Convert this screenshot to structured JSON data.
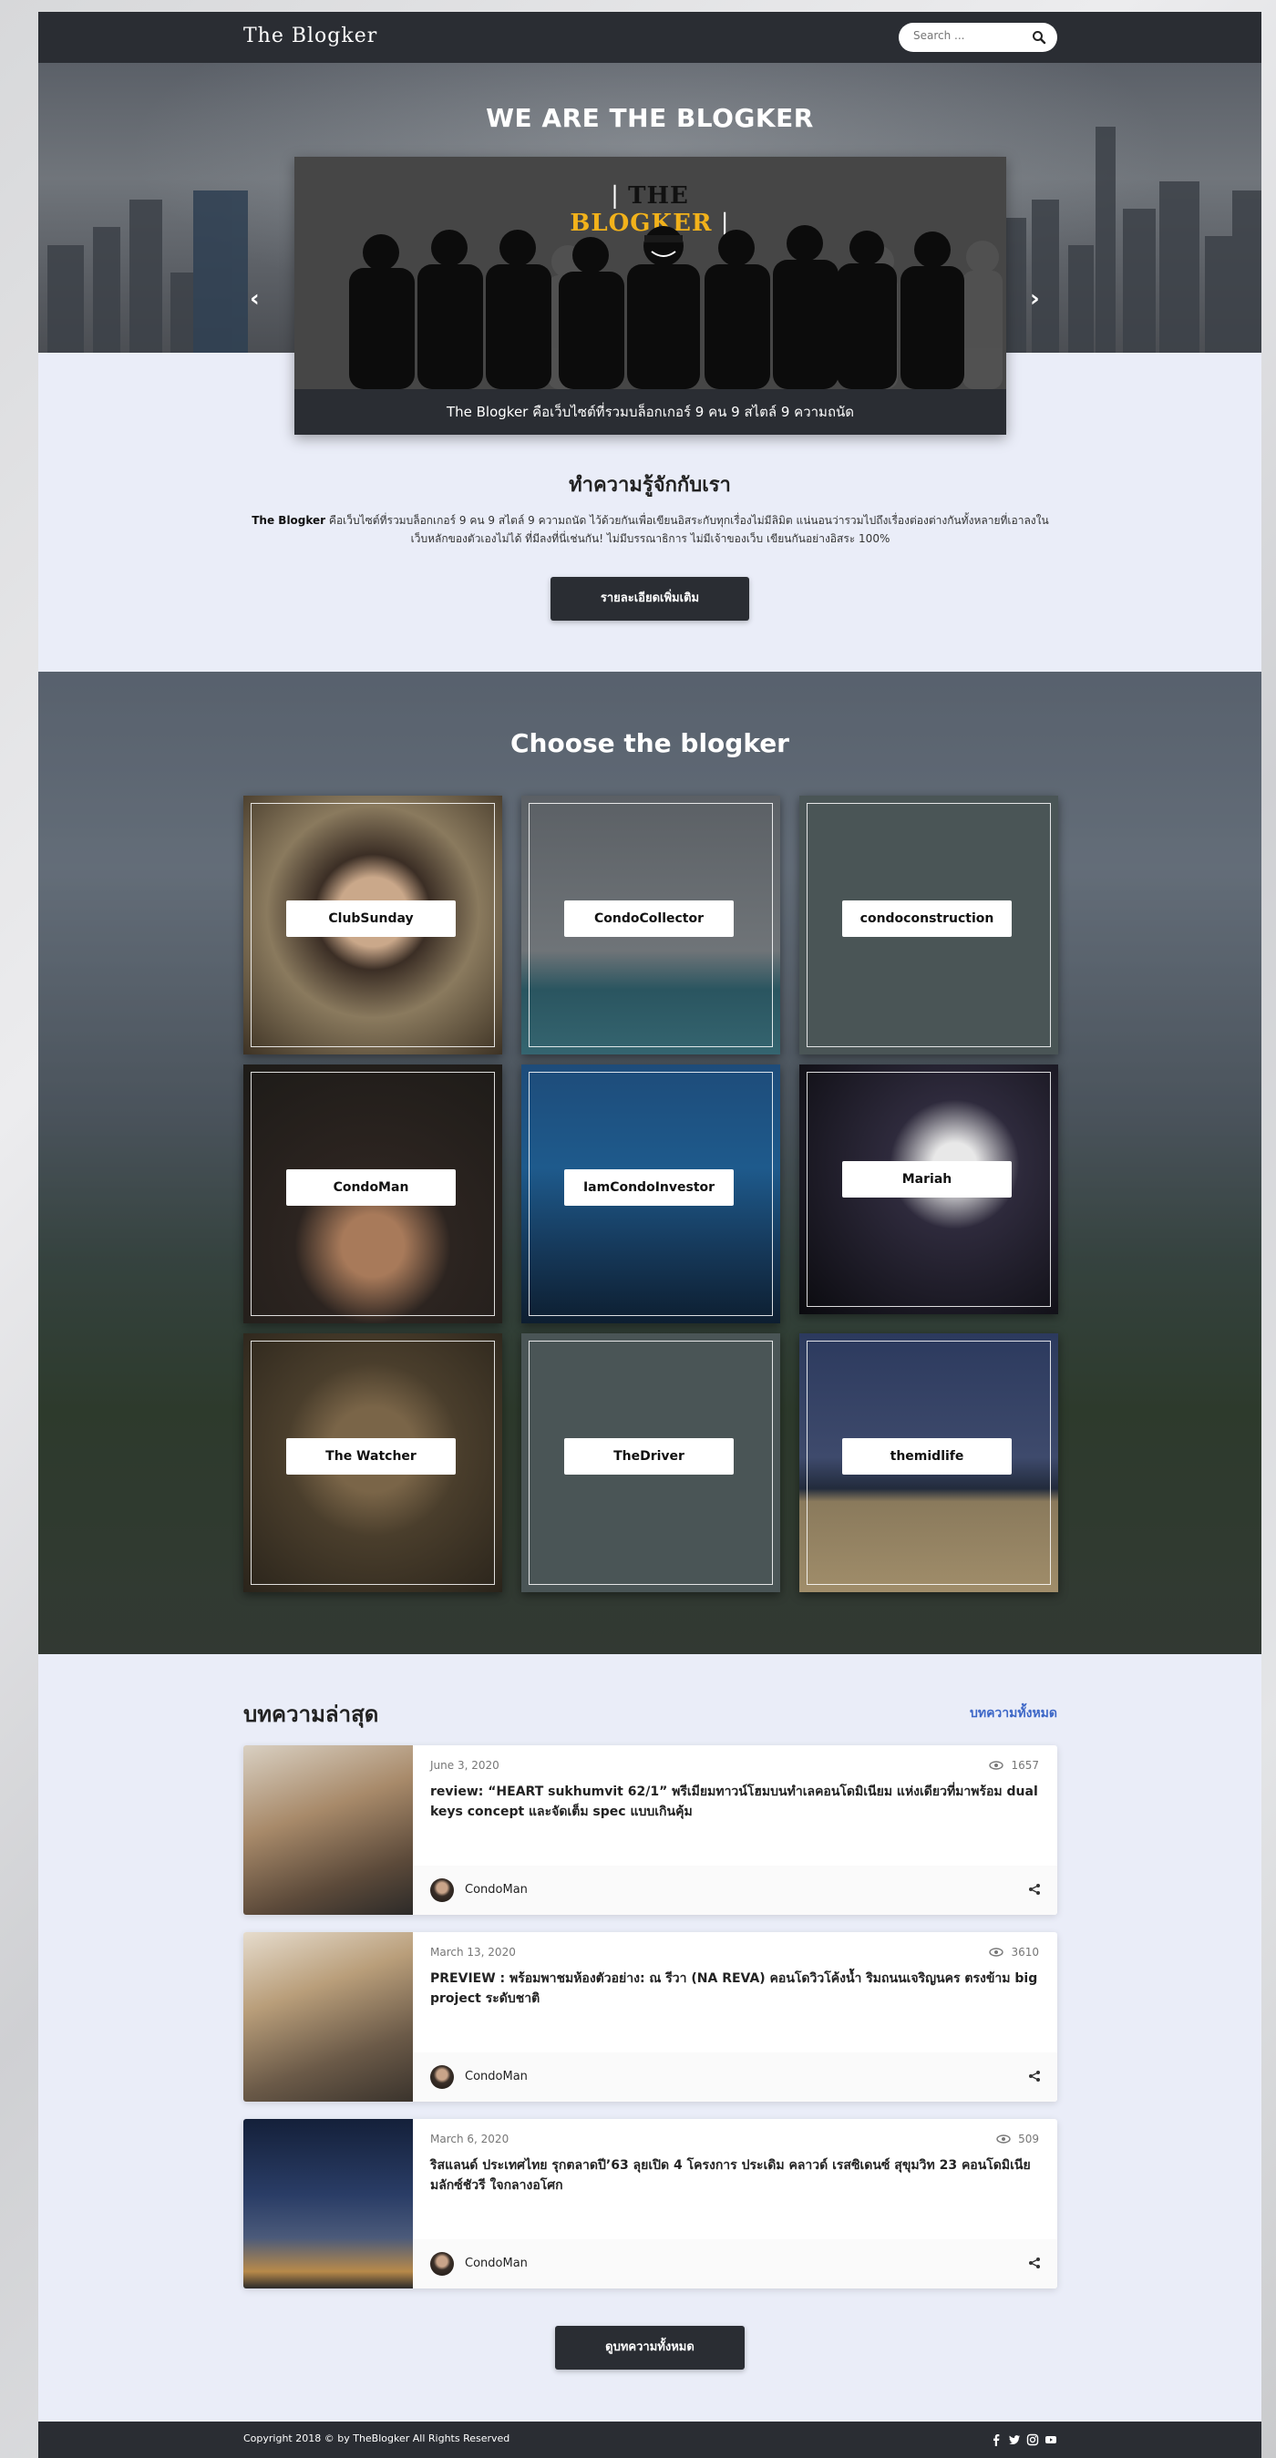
{
  "nav": {
    "brand": "The Blogker",
    "search_placeholder": "Search ..."
  },
  "hero": {
    "title": "WE ARE THE BLOGKER",
    "slide_logo_left": "THE",
    "slide_logo_right": "BLOGKER",
    "slide_caption": "The Blogker คือเว็บไซต์ที่รวมบล็อกเกอร์ 9 คน 9 สไตล์ 9 ความถนัด",
    "prev_arrow": "‹",
    "next_arrow": "›"
  },
  "about": {
    "title": "ทำความรู้จักกับเรา",
    "text_bold": "The Blogker",
    "text": " คือเว็บไซต์ที่รวมบล็อกเกอร์ 9 คน 9 สไตล์ 9 ความถนัด ไว้ด้วยกันเพื่อเขียนอิสระกับทุกเรื่องไม่มีลิมิต แน่นอนว่ารวมไปถึงเรื่องต่องต่างกันทั้งหลายที่เอาลงใน เว็บหลักของตัวเองไม่ได้ ที่มีลงที่นี่เช่นกัน! ไม่มีบรรณาธิการ ไม่มีเจ้าของเว็บ เขียนกันอย่างอิสระ 100%",
    "button": "รายละเอียดเพิ่มเติม"
  },
  "bloggers": {
    "title": "Choose the blogker",
    "items": [
      {
        "name": "ClubSunday"
      },
      {
        "name": "CondoCollector"
      },
      {
        "name": "condoconstruction"
      },
      {
        "name": "CondoMan"
      },
      {
        "name": "IamCondoInvestor"
      },
      {
        "name": "Mariah"
      },
      {
        "name": "The Watcher"
      },
      {
        "name": "TheDriver"
      },
      {
        "name": "themidlife"
      }
    ]
  },
  "latest": {
    "title": "บทความล่าสุด",
    "view_all": "บทความทั้งหมด",
    "articles": [
      {
        "date": "June 3, 2020",
        "views": "1657",
        "title": "review: “HEART sukhumvit 62/1” พรีเมียมทาวน์โฮมบนทำเลคอนโดมิเนียม แห่งเดียวที่มาพร้อม dual keys concept และจัดเต็ม spec แบบเกินคุ้ม",
        "author": "CondoMan"
      },
      {
        "date": "March 13, 2020",
        "views": "3610",
        "title": "PREVIEW : พร้อมพาชมห้องตัวอย่าง: ณ รีวา (NA REVA) คอนโดวิวโค้งน้ำ ริมถนนเจริญนคร ตรงข้าม big project ระดับชาติ",
        "author": "CondoMan"
      },
      {
        "date": "March 6, 2020",
        "views": "509",
        "title": "ริสแลนด์ ประเทศไทย รุกตลาดปี’63 ลุยเปิด 4 โครงการ ประเดิม คลาวด์ เรสซิเดนซ์ สุขุมวิท 23 คอนโดมิเนียมลักซ์ชัวรี ใจกลางอโศก",
        "author": "CondoMan"
      }
    ],
    "button": "ดูบทความทั้งหมด"
  },
  "footer": {
    "copyright": "Copyright 2018 © by TheBlogker All Rights Reserved"
  },
  "colors": {
    "nav": "#2a2d33",
    "page": "#eaedf8",
    "accent_link": "#3d67c7",
    "logo_yellow": "#f2b21b"
  }
}
